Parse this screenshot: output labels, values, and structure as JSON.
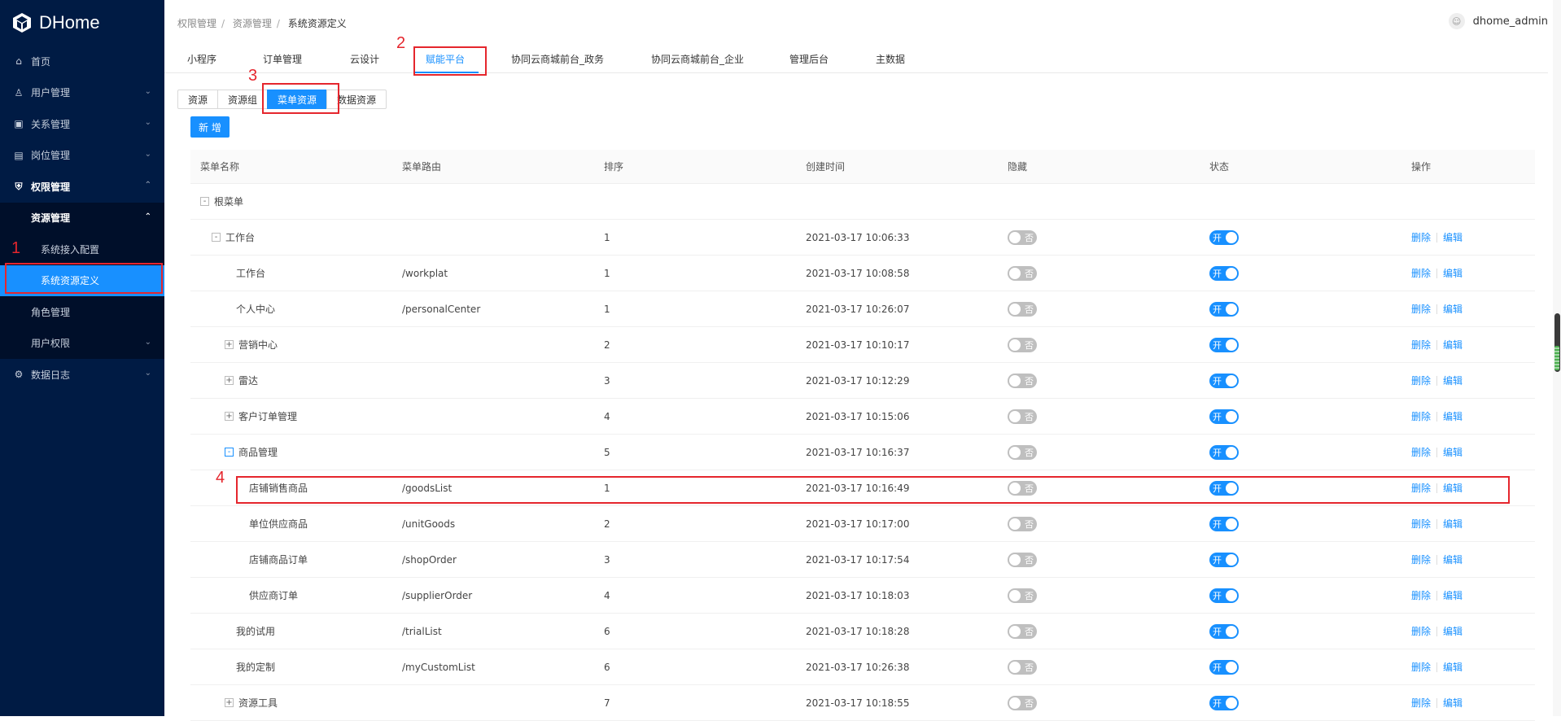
{
  "app": {
    "name": "DHome"
  },
  "sidebar": {
    "items": [
      {
        "label": "首页",
        "icon": "home-icon"
      },
      {
        "label": "用户管理",
        "icon": "user-icon"
      },
      {
        "label": "关系管理",
        "icon": "relation-icon"
      },
      {
        "label": "岗位管理",
        "icon": "position-icon"
      },
      {
        "label": "权限管理",
        "icon": "shield-icon"
      }
    ],
    "resource_mgmt": "资源管理",
    "sub_items": [
      "系统接入配置",
      "系统资源定义"
    ],
    "role_mgmt": "角色管理",
    "user_perm": "用户权限",
    "data_log": "数据日志"
  },
  "breadcrumb": [
    "权限管理",
    "资源管理",
    "系统资源定义"
  ],
  "user": {
    "name": "dhome_admin"
  },
  "tabs": [
    "小程序",
    "订单管理",
    "云设计",
    "赋能平台",
    "协同云商城前台_政务",
    "协同云商城前台_企业",
    "管理后台",
    "主数据"
  ],
  "segments": [
    "资源",
    "资源组",
    "菜单资源",
    "数据资源"
  ],
  "add_button": "新 增",
  "table": {
    "headers": [
      "菜单名称",
      "菜单路由",
      "排序",
      "创建时间",
      "隐藏",
      "状态",
      "操作"
    ],
    "switch_off": "否",
    "switch_on": "开",
    "delete": "删除",
    "edit": "编辑",
    "root": "根菜单",
    "rows": [
      {
        "name": "工作台",
        "path": "",
        "sort": "1",
        "time": "2021-03-17 10:06:33",
        "level": 1,
        "exp": "-"
      },
      {
        "name": "工作台",
        "path": "/workplat",
        "sort": "1",
        "time": "2021-03-17 10:08:58",
        "level": 2,
        "exp": ""
      },
      {
        "name": "个人中心",
        "path": "/personalCenter",
        "sort": "1",
        "time": "2021-03-17 10:26:07",
        "level": 2,
        "exp": ""
      },
      {
        "name": "营销中心",
        "path": "",
        "sort": "2",
        "time": "2021-03-17 10:10:17",
        "level": 2,
        "exp": "+"
      },
      {
        "name": "雷达",
        "path": "",
        "sort": "3",
        "time": "2021-03-17 10:12:29",
        "level": 2,
        "exp": "+"
      },
      {
        "name": "客户订单管理",
        "path": "",
        "sort": "4",
        "time": "2021-03-17 10:15:06",
        "level": 2,
        "exp": "+"
      },
      {
        "name": "商品管理",
        "path": "",
        "sort": "5",
        "time": "2021-03-17 10:16:37",
        "level": 2,
        "exp": "-b"
      },
      {
        "name": "店铺销售商品",
        "path": "/goodsList",
        "sort": "1",
        "time": "2021-03-17 10:16:49",
        "level": 3,
        "exp": ""
      },
      {
        "name": "单位供应商品",
        "path": "/unitGoods",
        "sort": "2",
        "time": "2021-03-17 10:17:00",
        "level": 3,
        "exp": ""
      },
      {
        "name": "店铺商品订单",
        "path": "/shopOrder",
        "sort": "3",
        "time": "2021-03-17 10:17:54",
        "level": 3,
        "exp": ""
      },
      {
        "name": "供应商订单",
        "path": "/supplierOrder",
        "sort": "4",
        "time": "2021-03-17 10:18:03",
        "level": 3,
        "exp": ""
      },
      {
        "name": "我的试用",
        "path": "/trialList",
        "sort": "6",
        "time": "2021-03-17 10:18:28",
        "level": 2,
        "exp": ""
      },
      {
        "name": "我的定制",
        "path": "/myCustomList",
        "sort": "6",
        "time": "2021-03-17 10:26:38",
        "level": 2,
        "exp": ""
      },
      {
        "name": "资源工具",
        "path": "",
        "sort": "7",
        "time": "2021-03-17 10:18:55",
        "level": 2,
        "exp": "+"
      }
    ]
  },
  "annotations": [
    "1",
    "2",
    "3",
    "4"
  ],
  "colors": {
    "primary": "#1890ff",
    "sidebar": "#001b44",
    "annotation": "#e5262d"
  }
}
